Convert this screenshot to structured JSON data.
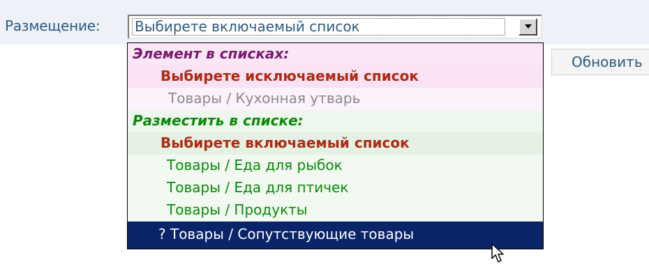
{
  "form": {
    "placement_label": "Размещение:",
    "selected_value": "Выбирете включаемый список",
    "update_button": "Обновить"
  },
  "dropdown": {
    "options": [
      {
        "text": "Элемент в списках:",
        "kind": "group",
        "color": "#7a1a6c",
        "background": "#fbe6f8"
      },
      {
        "text": "Выбирете исключаемый список",
        "kind": "option",
        "color": "#b02a12",
        "background": "#f8e2f4"
      },
      {
        "text": "Товары / Кухонная утварь",
        "kind": "option",
        "color": "#8a8a8a",
        "background": "#fdf2fb"
      },
      {
        "text": "Разместить в списке:",
        "kind": "group",
        "color": "#0a8a0a",
        "background": "#eef7ee"
      },
      {
        "text": "Выбирете включаемый список",
        "kind": "option",
        "color": "#b02a12",
        "background": "#e4f1e4"
      },
      {
        "text": "Товары / Еда для рыбок",
        "kind": "option",
        "color": "#0a8a0a",
        "background": "#f1f9f1"
      },
      {
        "text": "Товары / Еда для птичек",
        "kind": "option",
        "color": "#0a8a0a",
        "background": "#f1f9f1"
      },
      {
        "text": "Товары / Продукты",
        "kind": "option",
        "color": "#0a8a0a",
        "background": "#f1f9f1"
      },
      {
        "text": "? Товары / Сопутствующие товары",
        "kind": "option",
        "color": "#ffffff",
        "background": "#0a246a",
        "selected": true
      }
    ]
  },
  "icons": {
    "cursor": "mouse-pointer-icon",
    "dropdown_arrow": "chevron-down-icon"
  }
}
